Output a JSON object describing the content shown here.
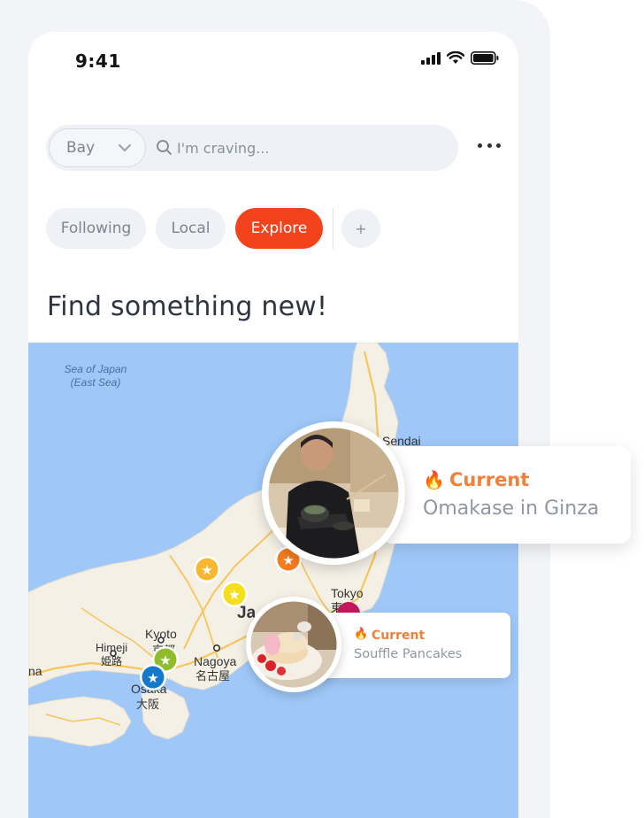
{
  "status_bar": {
    "time": "9:41"
  },
  "search": {
    "location": "Bay",
    "placeholder": "I'm craving..."
  },
  "tabs": [
    {
      "label": "Following",
      "active": false
    },
    {
      "label": "Local",
      "active": false
    },
    {
      "label": "Explore",
      "active": true
    }
  ],
  "add_tab_label": "+",
  "heading": "Find something new!",
  "map": {
    "labels": {
      "sea1": "Sea of Japan",
      "sea2": "(East Sea)",
      "sendai": "Sendai",
      "tokyo": "Tokyo",
      "tokyo_jp": "東京",
      "kyoto": "Kyoto",
      "kyoto_jp": "京都",
      "himeji": "Himeji",
      "himeji_jp": "姫路",
      "nagoya": "Nagoya",
      "nagoya_jp": "名古屋",
      "osaka": "Osaka",
      "osaka_jp": "大阪",
      "japan_partial": "Ja",
      "edge_partial": "na"
    }
  },
  "cards": {
    "featured": {
      "badge_icon": "🔥",
      "badge": "Current",
      "title": "Omakase in Ginza"
    },
    "secondary": {
      "badge_icon": "🔥",
      "badge": "Current",
      "title": "Souffle Pancakes"
    }
  },
  "colors": {
    "accent": "#f2431c",
    "badge_text": "#f2803a",
    "map_water": "#9fc8f9",
    "map_land": "#f4f0e6"
  }
}
